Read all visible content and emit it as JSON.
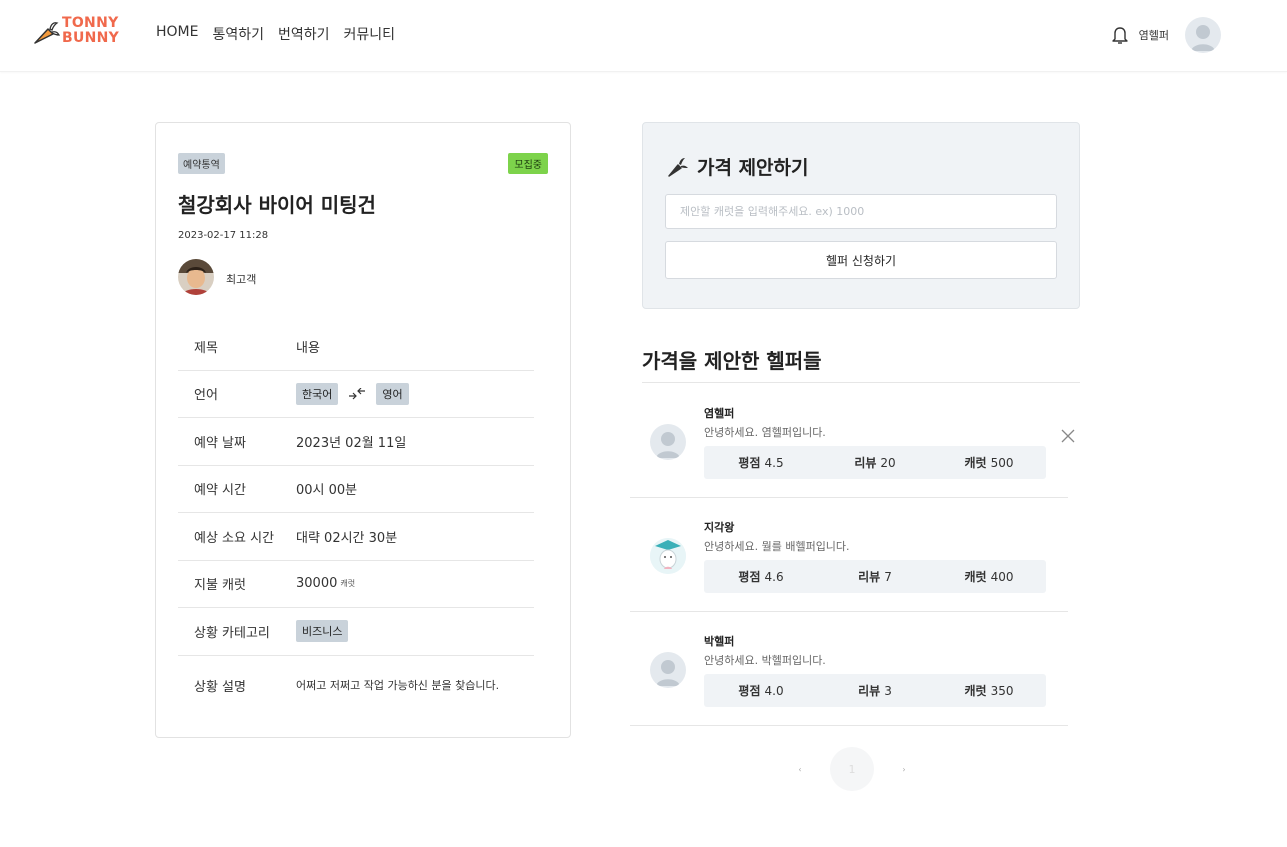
{
  "header": {
    "logo_line1": "TONNY",
    "logo_line2": "BUNNY",
    "nav": [
      "HOME",
      "통역하기",
      "번역하기",
      "커뮤니티"
    ],
    "username": "염헬퍼"
  },
  "request": {
    "type_tag": "예약통역",
    "status_tag": "모집중",
    "title": "철강회사 바이어 미팅건",
    "datetime": "2023-02-17 11:28",
    "customer": "최고객",
    "table": {
      "head_key": "제목",
      "head_val": "내용",
      "lang_key": "언어",
      "lang_from": "한국어",
      "lang_to": "영어",
      "date_key": "예약 날짜",
      "date_val": "2023년 02월 11일",
      "time_key": "예약 시간",
      "time_val": "00시 00분",
      "duration_key": "예상 소요 시간",
      "duration_val": "대략 02시간 30분",
      "carrot_key": "지불 캐럿",
      "carrot_val": "30000",
      "carrot_unit": "캐럿",
      "category_key": "상황 카테고리",
      "category_val": "비즈니스",
      "desc_key": "상황 설명",
      "desc_val": "어쩌고 저쩌고 작업 가능하신 분을 찾습니다."
    }
  },
  "price_offer": {
    "title": "가격 제안하기",
    "placeholder": "제안할 캐럿을 입력해주세요. ex) 1000",
    "apply_label": "헬퍼 신청하기"
  },
  "helpers": {
    "title": "가격을 제안한 헬퍼들",
    "rating_label": "평점",
    "review_label": "리뷰",
    "carrot_label": "캐럿",
    "items": [
      {
        "name": "염헬퍼",
        "intro": "안녕하세요. 염헬퍼입니다.",
        "rating": "4.5",
        "reviews": "20",
        "carrot": "500"
      },
      {
        "name": "지각왕",
        "intro": "안녕하세요. 뭘를 배헬퍼입니다.",
        "rating": "4.6",
        "reviews": "7",
        "carrot": "400"
      },
      {
        "name": "박헬퍼",
        "intro": "안녕하세요. 박헬퍼입니다.",
        "rating": "4.0",
        "reviews": "3",
        "carrot": "350"
      }
    ]
  },
  "pagination": {
    "prev": "‹",
    "current": "1",
    "next": "›"
  },
  "colors": {
    "accent": "#f0694c",
    "status": "#7dd34b",
    "chip": "#c9d2da",
    "panel": "#f0f3f6"
  }
}
